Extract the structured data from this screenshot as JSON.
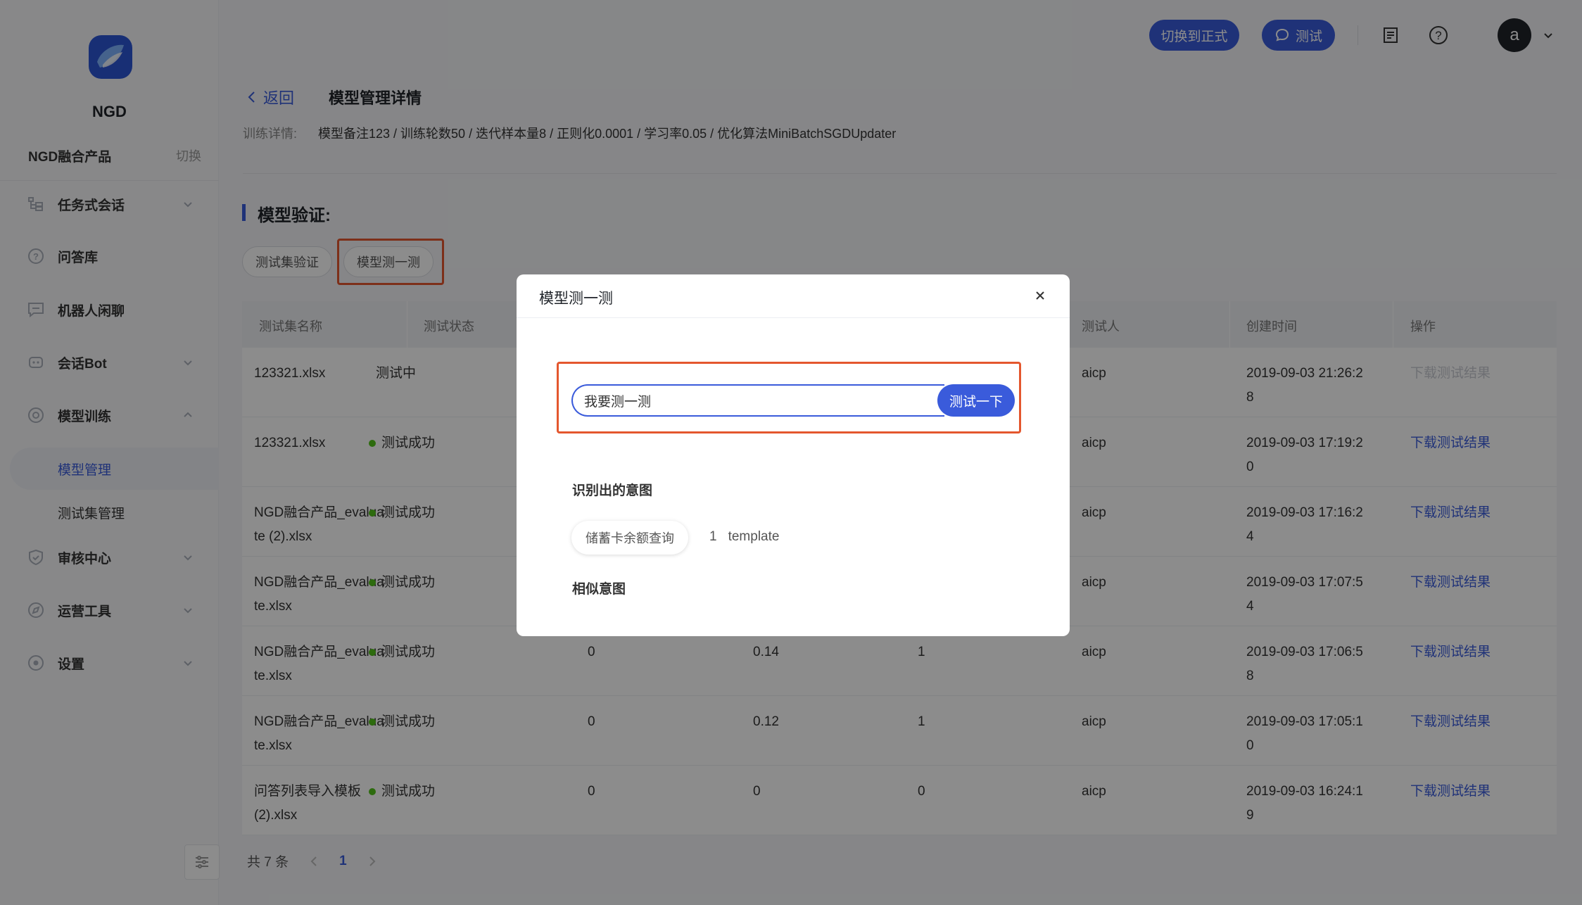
{
  "sidebar": {
    "logo_text": "NGD",
    "product": "NGD融合产品",
    "switch": "切换",
    "menu": [
      {
        "label": "任务式会话"
      },
      {
        "label": "问答库"
      },
      {
        "label": "机器人闲聊"
      },
      {
        "label": "会话Bot"
      },
      {
        "label": "模型训练"
      },
      {
        "label": "审核中心"
      },
      {
        "label": "运营工具"
      },
      {
        "label": "设置"
      }
    ],
    "submenu": [
      "模型管理",
      "测试集管理"
    ]
  },
  "header": {
    "formal_btn": "切换到正式",
    "test_btn": "测试",
    "avatar": "a"
  },
  "page": {
    "back": "返回",
    "title": "模型管理详情",
    "train_label": "训练详情:",
    "train_value": "模型备注123 / 训练轮数50 / 迭代样本量8 / 正则化0.0001 / 学习率0.05 / 优化算法MiniBatchSGDUpdater",
    "section_title": "模型验证:",
    "tabs": [
      "测试集验证",
      "模型测一测"
    ]
  },
  "table": {
    "headers": [
      "测试集名称",
      "测试状态",
      "测试人",
      "创建时间",
      "操作"
    ],
    "rows": [
      {
        "name": [
          "123321.xlsx",
          ""
        ],
        "status": "测试中",
        "ok": false,
        "c1": "",
        "c2": "",
        "c3": "",
        "tester": "aicp",
        "time": [
          "2019-09-03 21:26:2",
          "8"
        ],
        "op": "下载测试结果"
      },
      {
        "name": [
          "123321.xlsx",
          ""
        ],
        "status": "测试成功",
        "ok": true,
        "c1": "",
        "c2": "",
        "c3": "",
        "tester": "aicp",
        "time": [
          "2019-09-03 17:19:2",
          "0"
        ],
        "op": "下载测试结果"
      },
      {
        "name": [
          "NGD融合产品_evalua",
          "te (2).xlsx"
        ],
        "status": "测试成功",
        "ok": true,
        "c1": "",
        "c2": "",
        "c3": "",
        "tester": "aicp",
        "time": [
          "2019-09-03 17:16:2",
          "4"
        ],
        "op": "下载测试结果"
      },
      {
        "name": [
          "NGD融合产品_evalua",
          "te.xlsx"
        ],
        "status": "测试成功",
        "ok": true,
        "c1": "",
        "c2": "",
        "c3": "",
        "tester": "aicp",
        "time": [
          "2019-09-03 17:07:5",
          "4"
        ],
        "op": "下载测试结果"
      },
      {
        "name": [
          "NGD融合产品_evalua",
          "te.xlsx"
        ],
        "status": "测试成功",
        "ok": true,
        "c1": "0",
        "c2": "0.14",
        "c3": "1",
        "tester": "aicp",
        "time": [
          "2019-09-03 17:06:5",
          "8"
        ],
        "op": "下载测试结果"
      },
      {
        "name": [
          "NGD融合产品_evalua",
          "te.xlsx"
        ],
        "status": "测试成功",
        "ok": true,
        "c1": "0",
        "c2": "0.12",
        "c3": "1",
        "tester": "aicp",
        "time": [
          "2019-09-03 17:05:1",
          "0"
        ],
        "op": "下载测试结果"
      },
      {
        "name": [
          "问答列表导入模板",
          "(2).xlsx"
        ],
        "status": "测试成功",
        "ok": true,
        "c1": "0",
        "c2": "0",
        "c3": "0",
        "tester": "aicp",
        "time": [
          "2019-09-03 16:24:1",
          "9"
        ],
        "op": "下载测试结果"
      }
    ],
    "pager": {
      "total": "共 7 条",
      "current": "1"
    }
  },
  "modal": {
    "title": "模型测一测",
    "input_value": "我要测一测",
    "test_btn": "测试一下",
    "recognized_label": "识别出的意图",
    "intent": "储蓄卡余额查询",
    "intent_count": "1",
    "intent_source": "template",
    "similar_label": "相似意图"
  },
  "colors": {
    "accent": "#3a5bdb",
    "highlight": "#e4572e",
    "success": "#52c41a"
  }
}
